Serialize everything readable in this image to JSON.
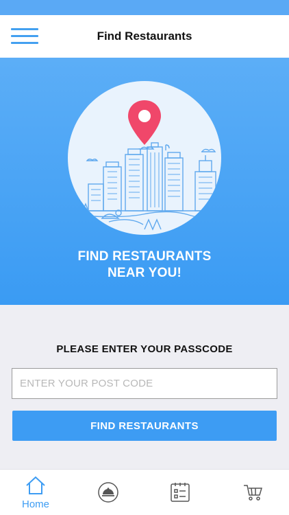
{
  "header": {
    "title": "Find Restaurants",
    "menu_icon": "hamburger-menu-icon"
  },
  "hero": {
    "illustration_icon": "city-location-pin-illustration",
    "heading_line1": "FIND RESTAURANTS",
    "heading_line2": "NEAR YOU!"
  },
  "form": {
    "passcode_label": "PLEASE ENTER YOUR PASSCODE",
    "postcode_placeholder": "ENTER YOUR POST CODE",
    "postcode_value": "",
    "submit_label": "FIND RESTAURANTS"
  },
  "tabbar": {
    "tabs": [
      {
        "label": "Home",
        "icon": "home-icon",
        "active": true
      },
      {
        "label": "",
        "icon": "cloche-icon",
        "active": false
      },
      {
        "label": "",
        "icon": "checklist-icon",
        "active": false
      },
      {
        "label": "",
        "icon": "cart-icon",
        "active": false
      }
    ]
  },
  "colors": {
    "accent": "#3d9cf3",
    "hero_top": "#5caef7",
    "pin": "#f0476a",
    "background": "#eeeef3"
  }
}
